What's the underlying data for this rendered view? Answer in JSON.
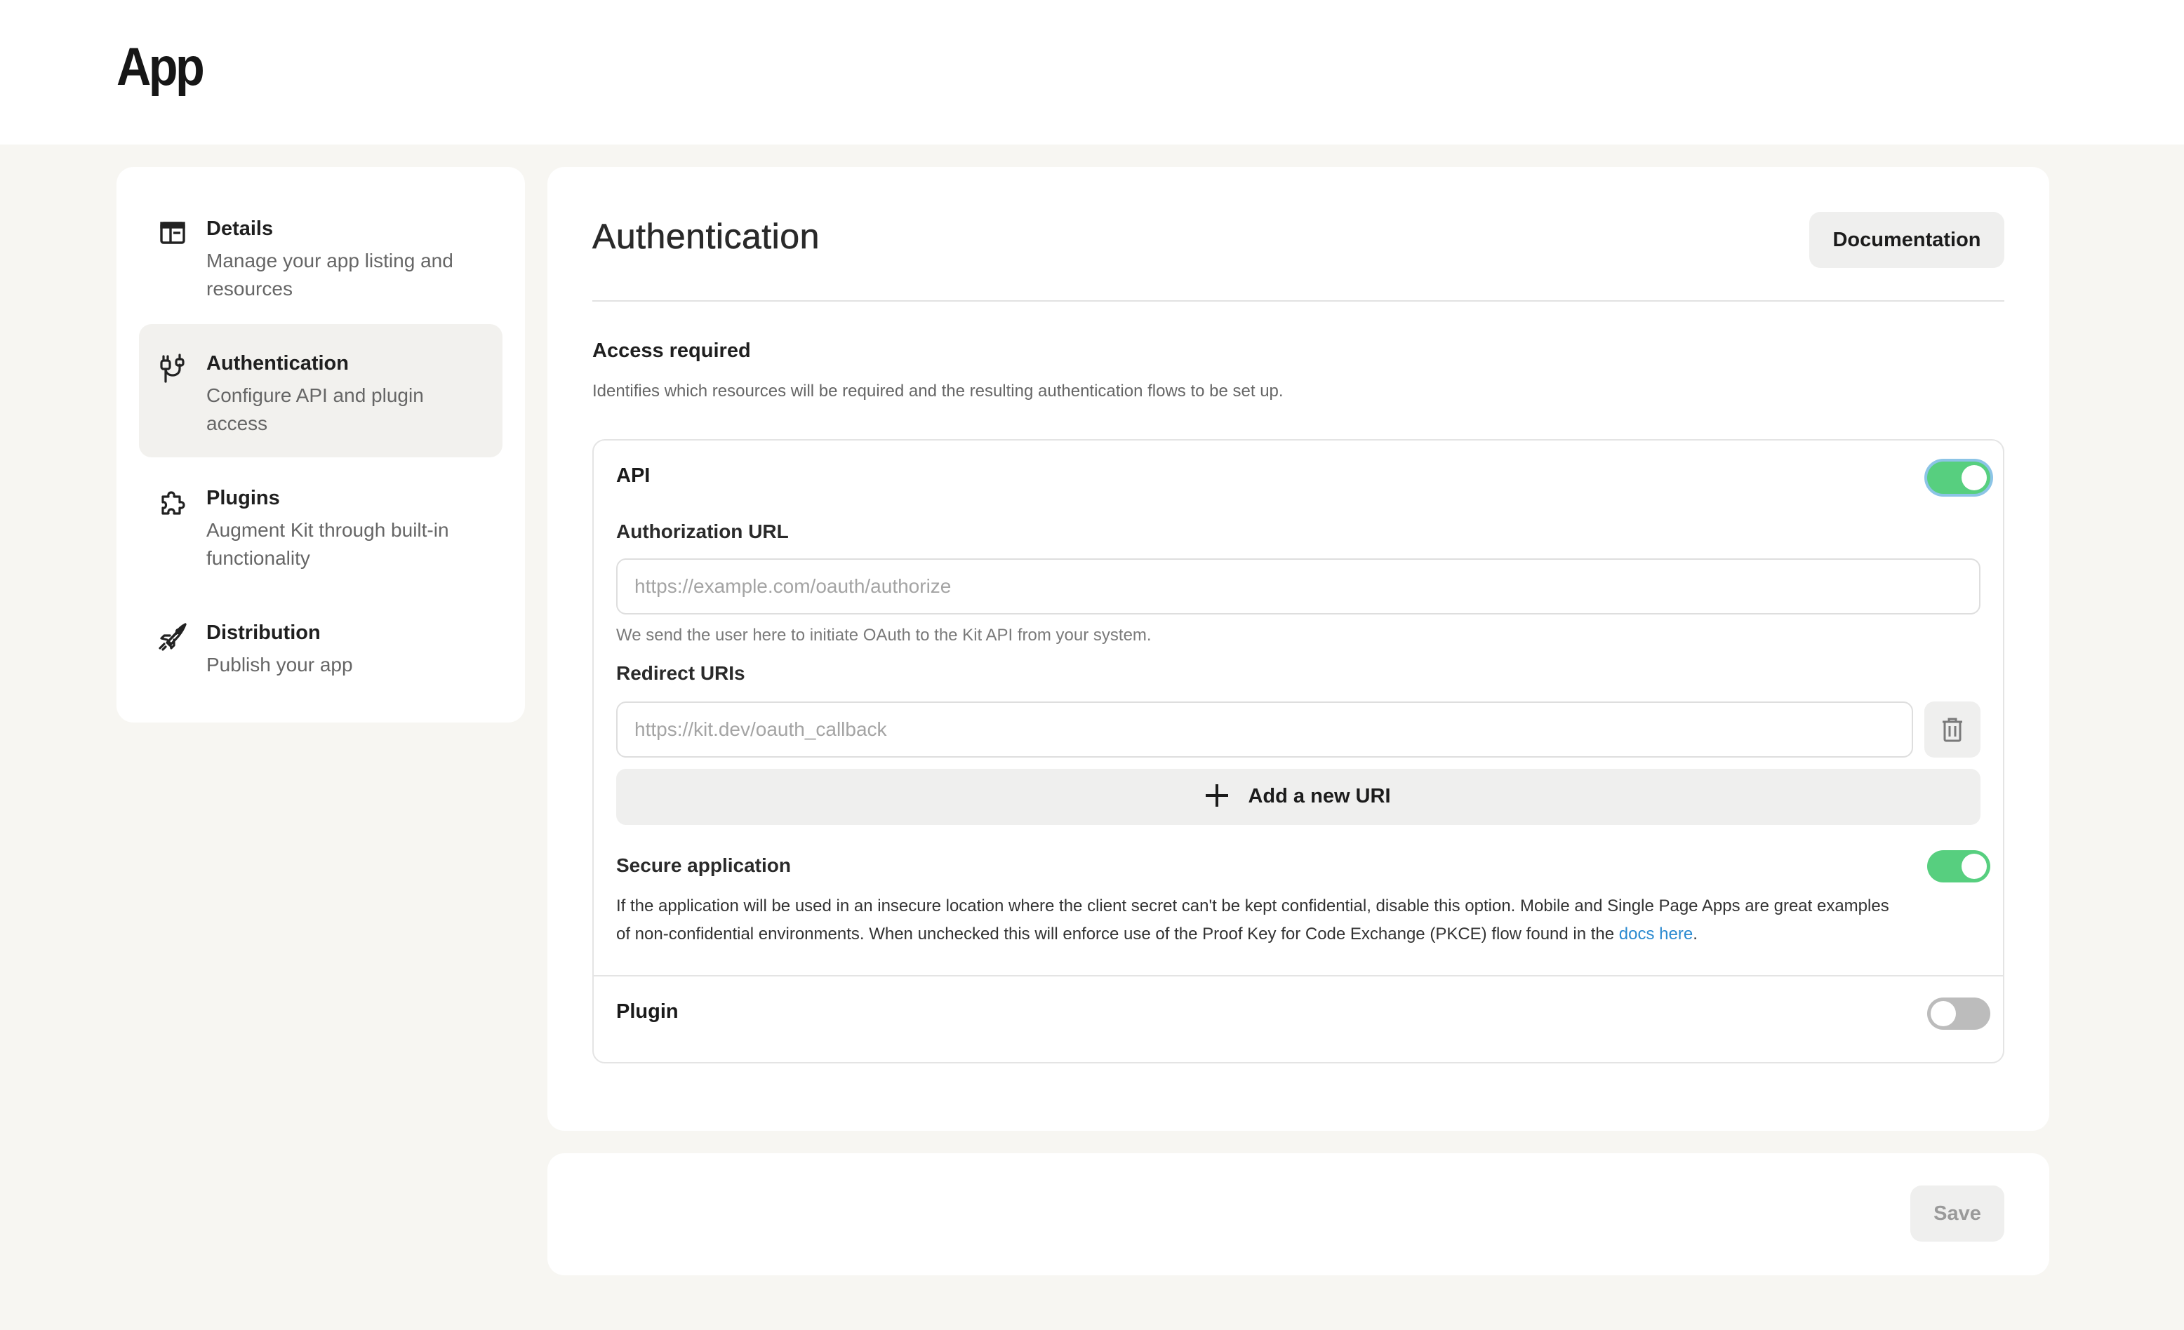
{
  "header": {
    "app_title": "App"
  },
  "sidebar": {
    "items": [
      {
        "title": "Details",
        "description": "Manage your app listing and resources",
        "icon": "layout-icon"
      },
      {
        "title": "Authentication",
        "description": "Configure API and plugin access",
        "icon": "plug-icon",
        "active": true
      },
      {
        "title": "Plugins",
        "description": "Augment Kit through built-in functionality",
        "icon": "puzzle-icon"
      },
      {
        "title": "Distribution",
        "description": "Publish your app",
        "icon": "rocket-icon"
      }
    ]
  },
  "main": {
    "title": "Authentication",
    "documentation_label": "Documentation",
    "access": {
      "title": "Access required",
      "description": "Identifies which resources will be required and the resulting authentication flows to be set up.",
      "api": {
        "label": "API",
        "enabled": true,
        "auth_url": {
          "label": "Authorization URL",
          "placeholder": "https://example.com/oauth/authorize",
          "value": "",
          "hint": "We send the user here to initiate OAuth to the Kit API from your system."
        },
        "redirect": {
          "label": "Redirect URIs",
          "placeholder": "https://kit.dev/oauth_callback",
          "value": "",
          "add_label": "Add a new URI"
        },
        "secure": {
          "label": "Secure application",
          "enabled": true,
          "description_line1": "If the application will be used in an insecure location where the client secret can't be kept confidential, disable this option. Mobile and Single Page Apps are great examples",
          "description_line2": "of non-confidential environments. When unchecked this will enforce use of the Proof Key for Code Exchange (PKCE) flow found in the ",
          "link_text": "docs here",
          "trailing": "."
        }
      },
      "plugin": {
        "label": "Plugin",
        "enabled": false
      }
    }
  },
  "footer": {
    "save_label": "Save"
  },
  "colors": {
    "toggle_on": "#57cf7f",
    "toggle_off": "#bcbcbc",
    "link": "#2b8ad0",
    "background": "#f7f6f2"
  }
}
